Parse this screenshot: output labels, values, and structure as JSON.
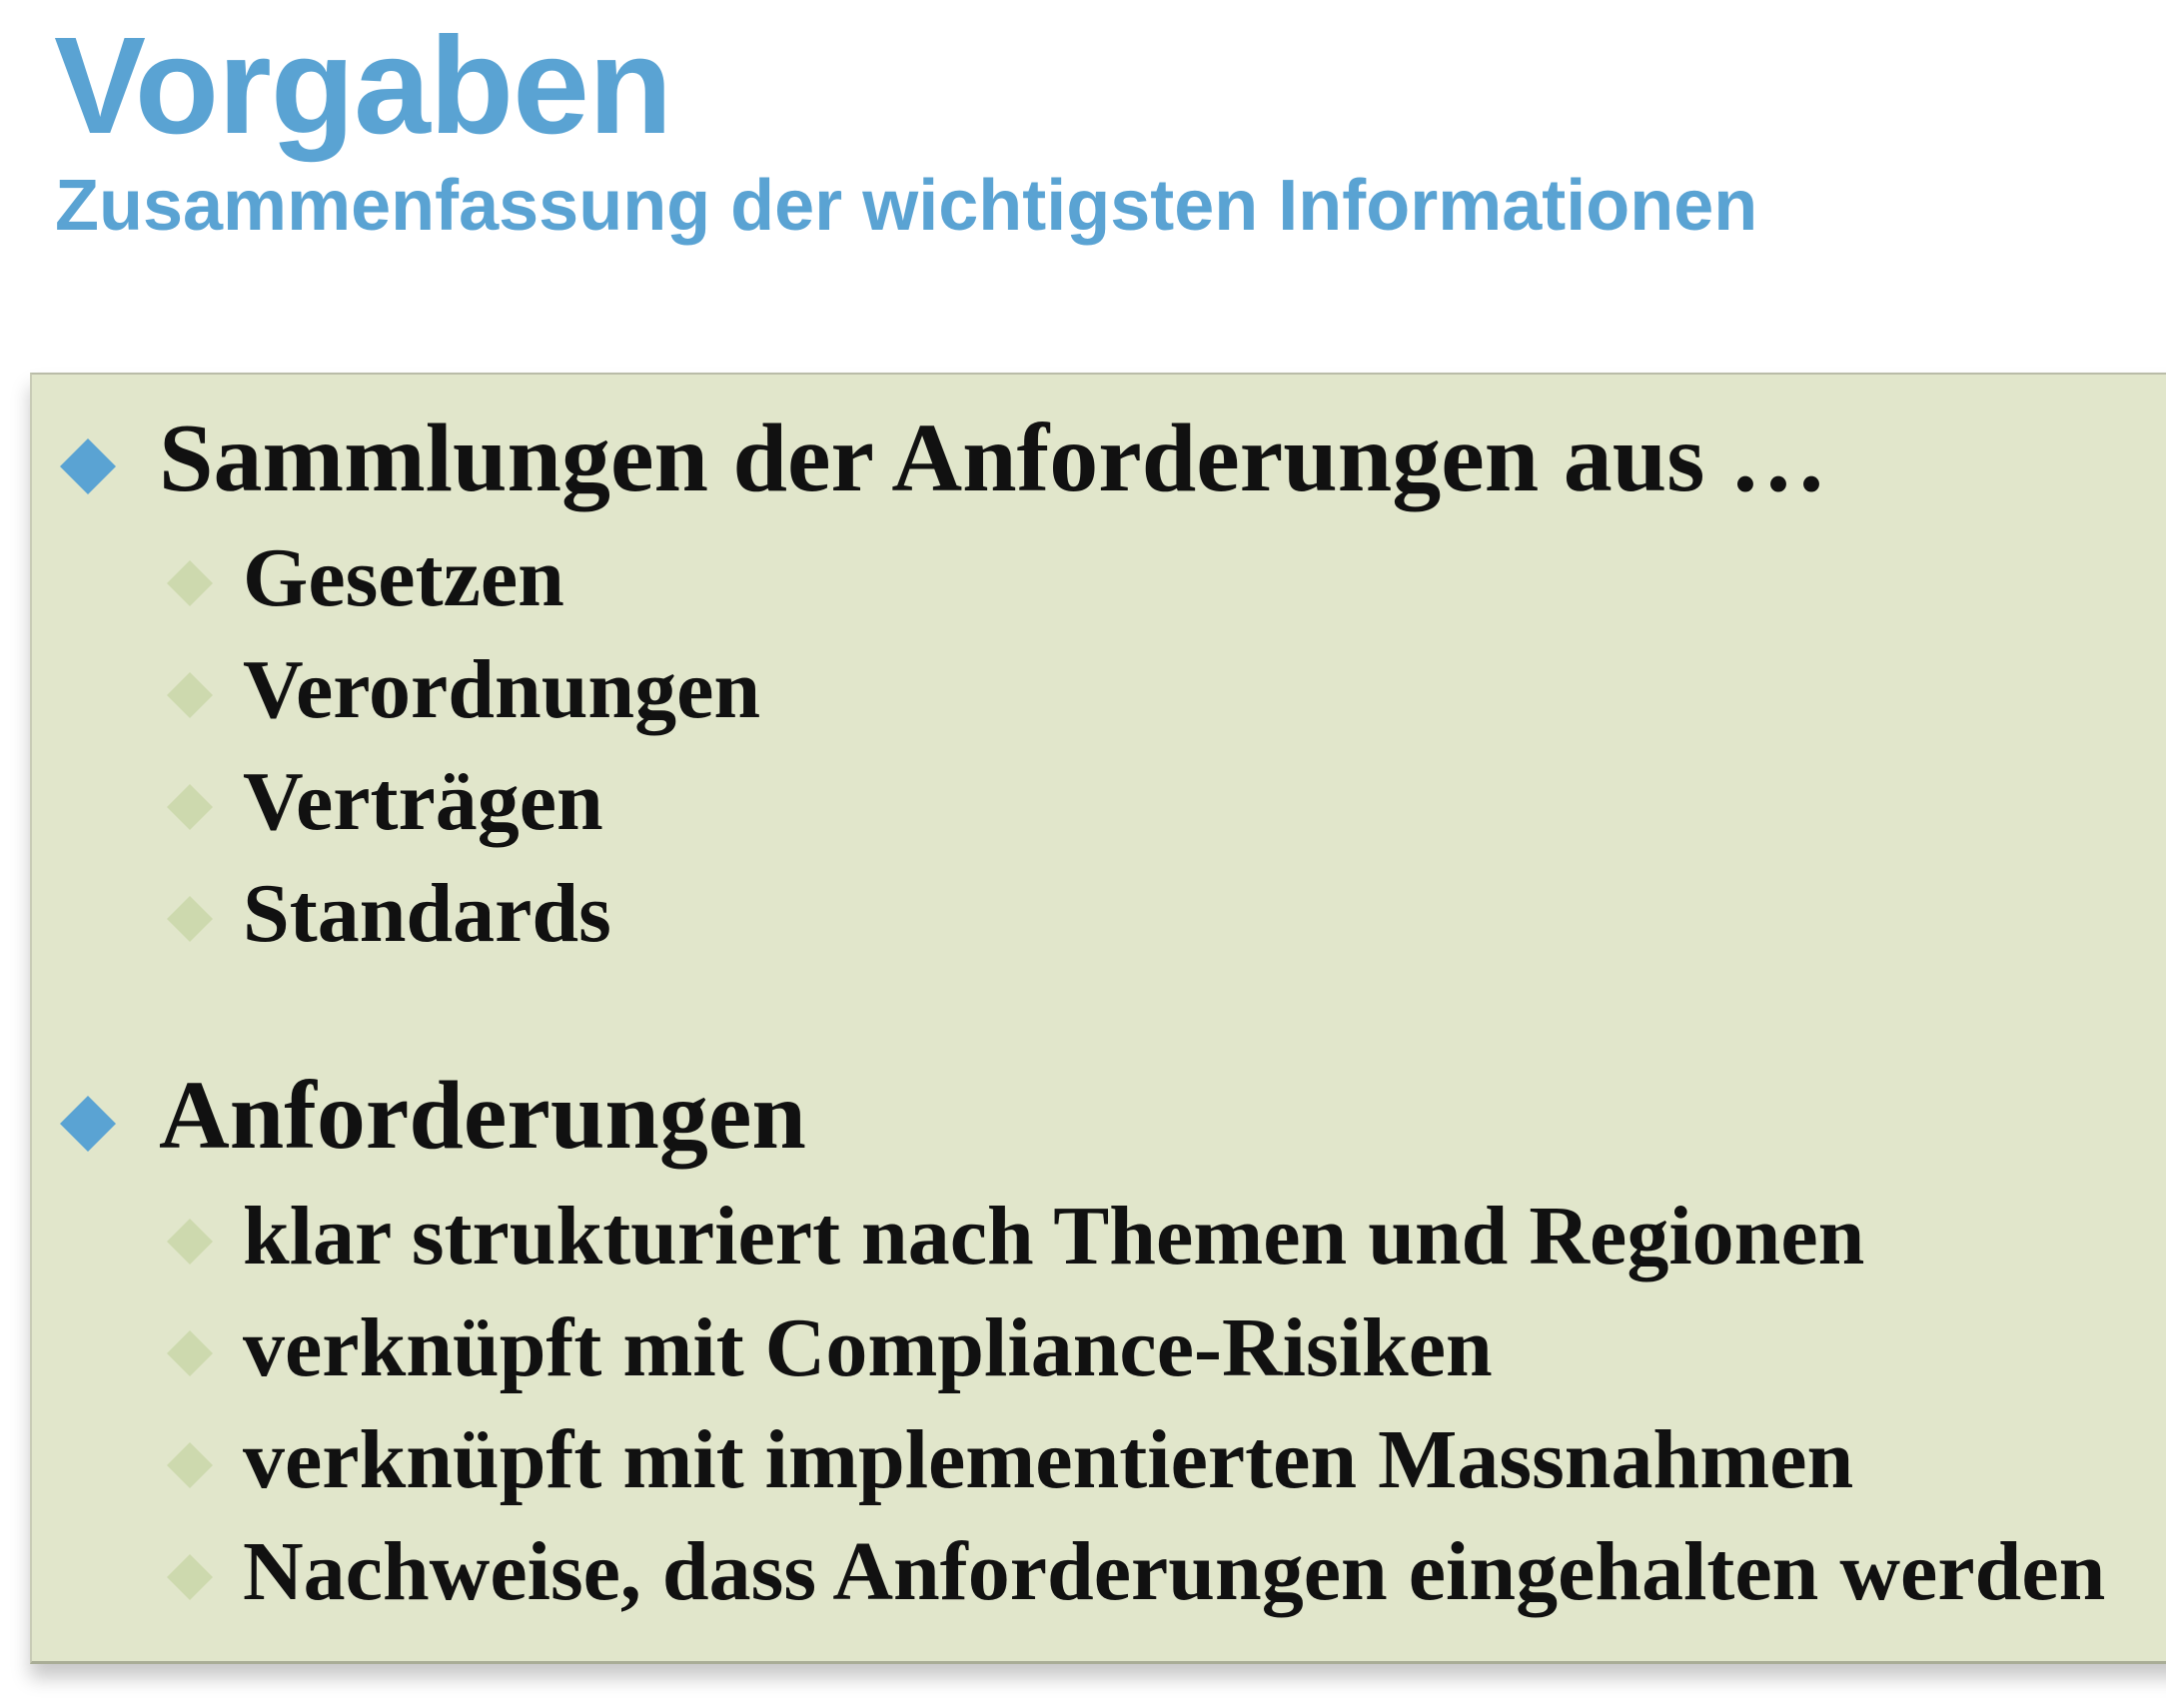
{
  "header": {
    "title": "Vorgaben",
    "subtitle": "Zusammenfassung der wichtigsten Informationen"
  },
  "colors": {
    "accent": "#5aa3d3",
    "box_background": "#e1e6cb",
    "sub_bullet": "#cdd9ae"
  },
  "content": {
    "sections": [
      {
        "heading": "Sammlungen der Anforderungen aus …",
        "items": [
          "Gesetzen",
          "Verordnungen",
          "Verträgen",
          "Standards"
        ]
      },
      {
        "heading": "Anforderungen",
        "items": [
          "klar strukturiert nach Themen und Regionen",
          "verknüpft mit Compliance-Risiken",
          "verknüpft mit implementierten Massnahmen",
          "Nachweise, dass Anforderungen eingehalten werden"
        ]
      }
    ]
  }
}
